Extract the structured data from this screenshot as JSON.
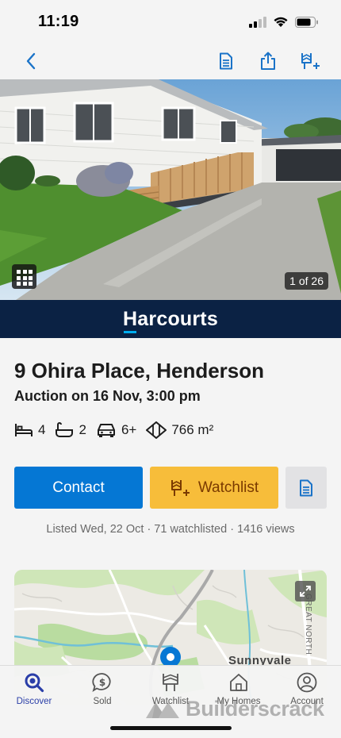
{
  "status_bar": {
    "time": "11:19"
  },
  "listing": {
    "photo_counter": "1 of 26",
    "agency": "Harcourts",
    "address": "9 Ohira Place, Henderson",
    "auction": "Auction on 16 Nov, 3:00 pm",
    "features": {
      "bedrooms": "4",
      "bathrooms": "2",
      "parking": "6+",
      "land_area": "766 m²"
    },
    "meta": "Listed Wed, 22 Oct  ·  71 watchlisted  ·  1416 views"
  },
  "actions": {
    "contact_label": "Contact",
    "watchlist_label": "Watchlist"
  },
  "map": {
    "suburb_label": "Sunnyvale",
    "road_label": "GREAT NORTH"
  },
  "tab_bar": {
    "items": [
      {
        "label": "Discover",
        "icon": "search-icon"
      },
      {
        "label": "Sold",
        "icon": "dollar-bubble-icon"
      },
      {
        "label": "Watchlist",
        "icon": "watchlist-icon"
      },
      {
        "label": "My Homes",
        "icon": "home-icon"
      },
      {
        "label": "Account",
        "icon": "account-icon"
      }
    ]
  },
  "watermark": "Builderscrack",
  "colors": {
    "accent_blue": "#0577d4",
    "watchlist_yellow": "#f7bd3a",
    "agency_navy": "#0b2244",
    "active_tab": "#2a3ea8"
  }
}
